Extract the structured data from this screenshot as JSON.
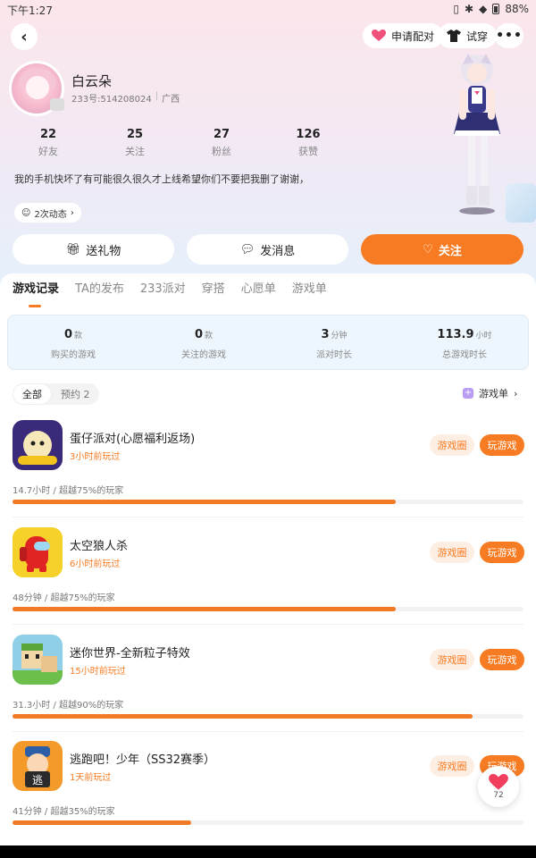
{
  "status_bar": {
    "time": "下午1:27",
    "battery": "88%"
  },
  "header": {
    "match_label": "申请配对",
    "try_label": "试穿",
    "more_label": "•••"
  },
  "profile": {
    "nickname": "白云朵",
    "uid": "233号:514208024",
    "region": "广西",
    "bio": "我的手机快坏了有可能很久很久才上线希望你们不要把我删了谢谢，",
    "persona_chip": "2次动态"
  },
  "stats": [
    {
      "value": "22",
      "label": "好友"
    },
    {
      "value": "25",
      "label": "关注"
    },
    {
      "value": "27",
      "label": "粉丝"
    },
    {
      "value": "126",
      "label": "获赞"
    }
  ],
  "actions": {
    "gift": "送礼物",
    "message": "发消息",
    "follow": "关注"
  },
  "tabs": [
    "游戏记录",
    "TA的发布",
    "233派对",
    "穿搭",
    "心愿单",
    "游戏单"
  ],
  "summary": [
    {
      "value": "0",
      "unit": "款",
      "label": "购买的游戏"
    },
    {
      "value": "0",
      "unit": "款",
      "label": "关注的游戏"
    },
    {
      "value": "3",
      "unit": "分钟",
      "label": "派对时长"
    },
    {
      "value": "113.9",
      "unit": "小时",
      "label": "总游戏时长"
    }
  ],
  "filters": {
    "all": "全部",
    "reserve": "预约 2",
    "gamelist": "游戏单"
  },
  "games": [
    {
      "title": "蛋仔派对(心愿福利返场)",
      "played": "3小时前玩过",
      "meta": "14.7小时 / 超越75%的玩家",
      "progress": 0.75,
      "circle_label": "游戏圈",
      "play_label": "玩游戏"
    },
    {
      "title": "太空狼人杀",
      "played": "6小时前玩过",
      "meta": "48分钟 / 超越75%的玩家",
      "progress": 0.75,
      "circle_label": "游戏圈",
      "play_label": "玩游戏"
    },
    {
      "title": "迷你世界-全新粒子特效",
      "played": "15小时前玩过",
      "meta": "31.3小时 / 超越90%的玩家",
      "progress": 0.9,
      "circle_label": "游戏圈",
      "play_label": "玩游戏"
    },
    {
      "title": "逃跑吧！少年（SS32赛季）",
      "played": "1天前玩过",
      "meta": "41分钟 / 超越35%的玩家",
      "progress": 0.35,
      "circle_label": "游戏圈",
      "play_label": "玩游戏"
    }
  ],
  "floating_like": {
    "count": "72"
  },
  "colors": {
    "accent": "#f77b22",
    "stats_bg": "#eef6fd"
  }
}
